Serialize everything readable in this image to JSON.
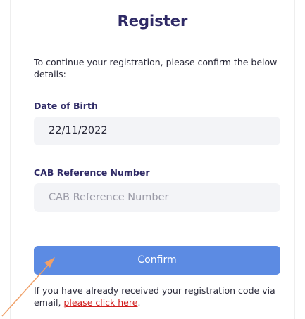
{
  "title": "Register",
  "intro": "To continue your registration, please confirm the below details:",
  "dob": {
    "label": "Date of Birth",
    "value": "22/11/2022"
  },
  "cab": {
    "label": "CAB Reference Number",
    "placeholder": "CAB Reference Number"
  },
  "confirm_label": "Confirm",
  "footer": {
    "text": "If you have already received your registration code via email, ",
    "link": "please click here",
    "period": "."
  },
  "colors": {
    "accent": "#5c8be3",
    "title": "#2f2a66",
    "link": "#d11f1f",
    "annotation_arrow": "#f0a068"
  }
}
